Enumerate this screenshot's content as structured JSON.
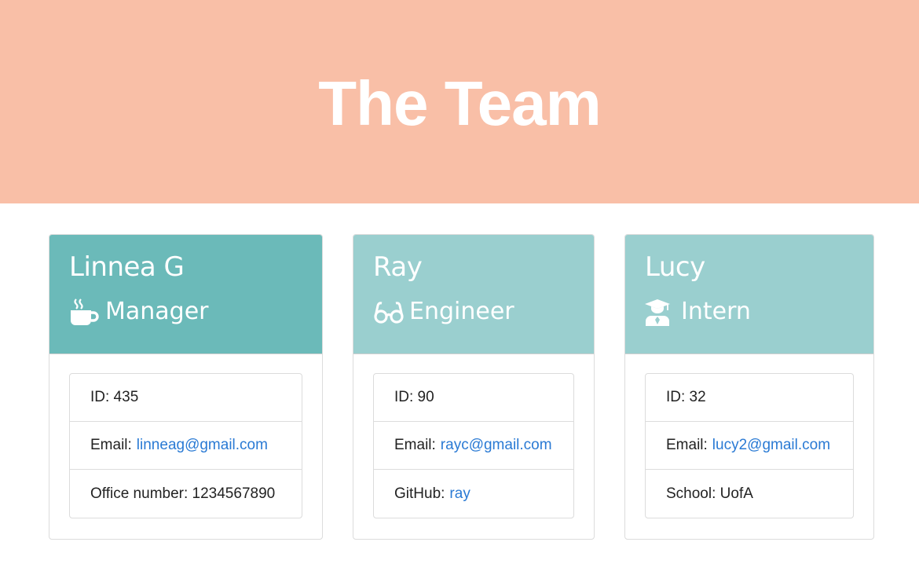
{
  "colors": {
    "hero_bg": "#f9bfa7",
    "manager_header": "#6bbab9",
    "team_header": "#9acfcf",
    "link": "#2a7ad4"
  },
  "hero": {
    "title": "The Team"
  },
  "cards": [
    {
      "name": "Linnea G",
      "role": "Manager",
      "icon": "coffee-mug-icon",
      "rows": [
        {
          "label": "ID: 435"
        },
        {
          "label": "Email:",
          "link": "linneag@gmail.com"
        },
        {
          "label": "Office number: 1234567890"
        }
      ]
    },
    {
      "name": "Ray",
      "role": "Engineer",
      "icon": "glasses-icon",
      "rows": [
        {
          "label": "ID: 90"
        },
        {
          "label": "Email:",
          "link": "rayc@gmail.com"
        },
        {
          "label": "GitHub:",
          "link": "ray"
        }
      ]
    },
    {
      "name": "Lucy",
      "role": "Intern",
      "icon": "graduate-icon",
      "rows": [
        {
          "label": "ID: 32"
        },
        {
          "label": "Email:",
          "link": "lucy2@gmail.com"
        },
        {
          "label": "School: UofA"
        }
      ]
    }
  ]
}
